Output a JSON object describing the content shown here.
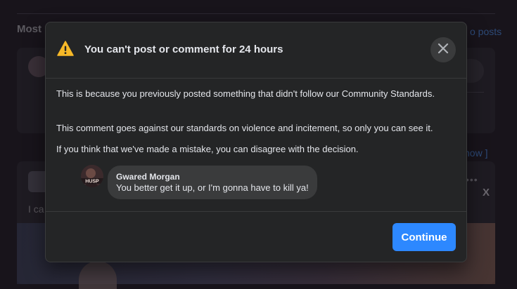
{
  "background": {
    "section_heading": "Most",
    "posts_link": "o posts",
    "show_link": "how ]",
    "menu_dots": "•••",
    "dismiss_x": "X",
    "post_text": "I ca"
  },
  "modal": {
    "icon": "warning-icon",
    "title": "You can't post or comment for 24 hours",
    "close_icon": "close-icon",
    "body": {
      "paragraph_1": "This is because you previously posted something that didn't follow our Community Standards.",
      "paragraph_2": "This comment goes against our standards on violence and incitement, so only you can see it.",
      "paragraph_3": "If you think that we've made a mistake, you can disagree with the decision."
    },
    "comment": {
      "avatar_text": "HUSP",
      "author": "Gwared Morgan",
      "text": "You better get it up, or I'm gonna have to kill ya!"
    },
    "continue_label": "Continue"
  },
  "colors": {
    "accent": "#2d88ff",
    "modal_bg": "#242526",
    "bubble_bg": "#3a3b3c",
    "warning": "#f7b928"
  }
}
